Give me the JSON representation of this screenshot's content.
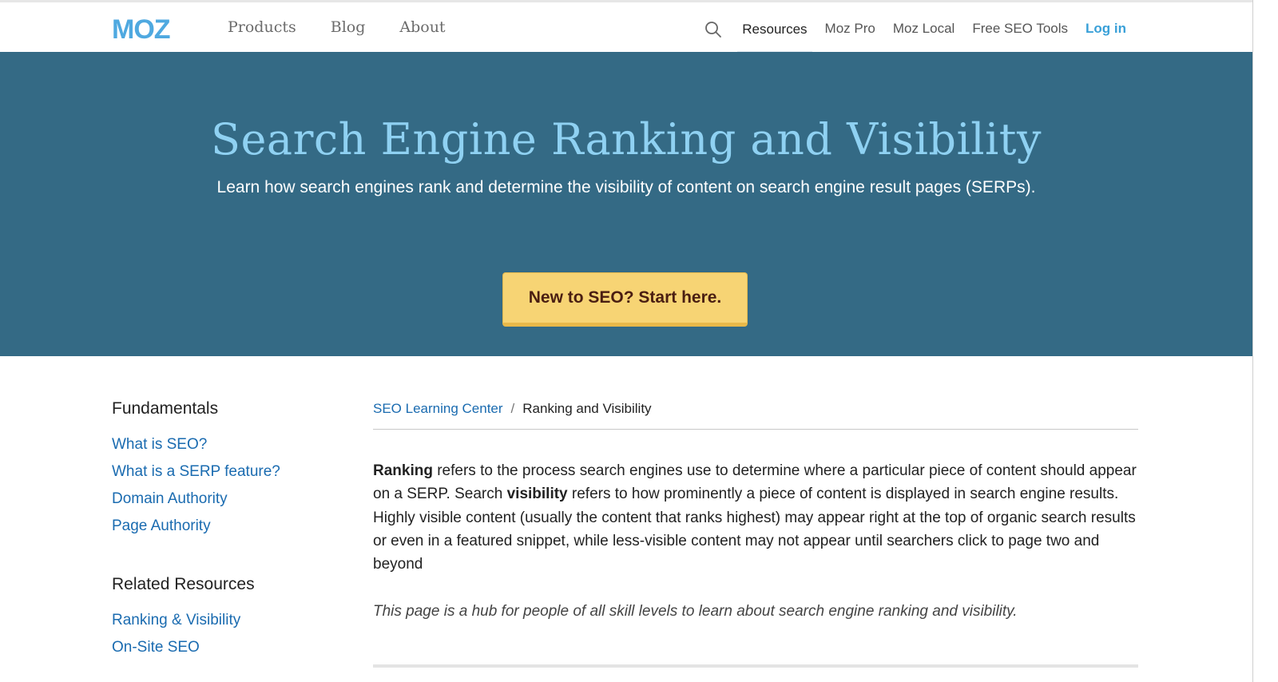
{
  "header": {
    "logo_text": "MOZ",
    "nav_left": [
      "Products",
      "Blog",
      "About"
    ],
    "search_icon": "search-icon",
    "nav_right": [
      "Resources",
      "Moz Pro",
      "Moz Local",
      "Free SEO Tools"
    ],
    "login_label": "Log in",
    "colors": {
      "logo": "#4fa9e0",
      "login": "#39a0d8"
    }
  },
  "hero": {
    "title": "Search Engine Ranking and Visibility",
    "subtitle": "Learn how search engines rank and determine the visibility of content on search engine result pages (SERPs).",
    "cta_label": "New to SEO? Start here.",
    "colors": {
      "background": "#346a85",
      "title": "#8fd1f2",
      "cta": "#f7d474"
    }
  },
  "sidebar": {
    "sections": [
      {
        "heading": "Fundamentals",
        "links": [
          "What is SEO?",
          "What is a SERP feature?",
          "Domain Authority",
          "Page Authority"
        ]
      },
      {
        "heading": "Related Resources",
        "links": [
          "Ranking & Visibility",
          "On-Site SEO"
        ]
      }
    ]
  },
  "main": {
    "breadcrumb": {
      "root": "SEO Learning Center",
      "separator": "/",
      "current": "Ranking and Visibility"
    },
    "paragraph": {
      "term1": "Ranking",
      "part1": " refers to the process search engines use to determine where a particular piece of content should appear on a SERP. Search ",
      "term2": "visibility",
      "part2": " refers to how prominently a piece of content is displayed in search engine results. Highly visible content (usually the content that ranks highest) may appear right at the top of organic search results or even in a featured snippet, while less-visible content may not appear until searchers click to page two and beyond"
    },
    "hub_note": "This page is a hub for people of all skill levels to learn about search engine ranking and visibility."
  }
}
